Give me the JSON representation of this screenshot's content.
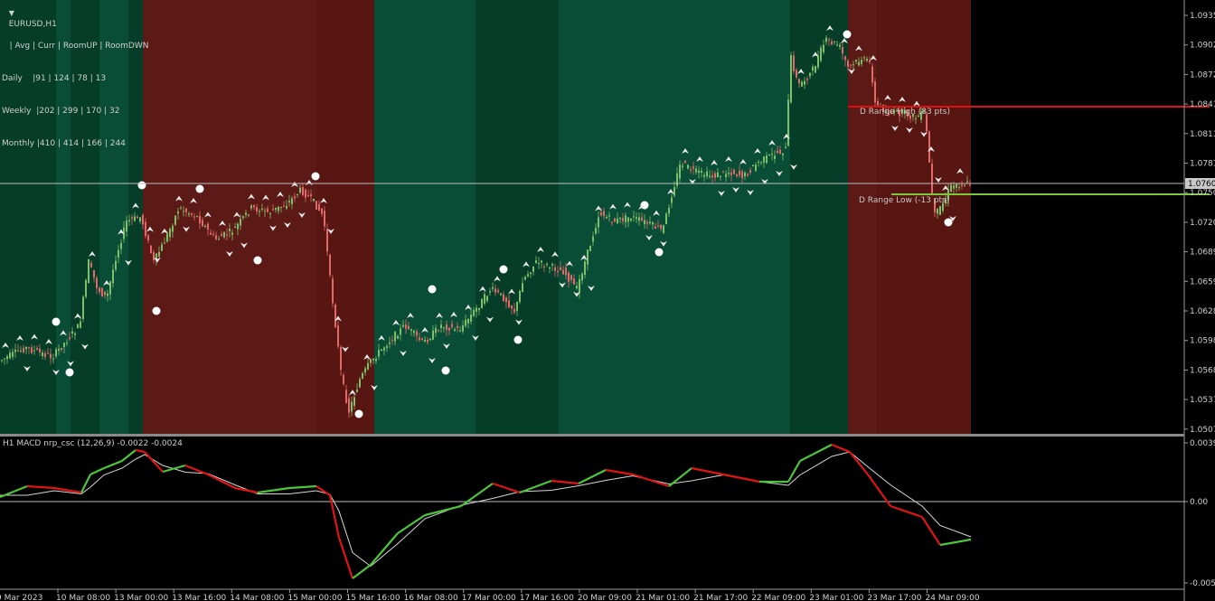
{
  "window": {
    "symbol_title": "EURUSD,H1"
  },
  "stats_table": {
    "header": "   | Avg | Curr | RoomUP | RoomDWN",
    "rows": [
      "Daily    |91 | 124 | 78 | 13",
      "Weekly  |202 | 299 | 170 | 32",
      "Monthly |410 | 414 | 166 | 244"
    ]
  },
  "price_axis": {
    "labels": [
      "1.0935",
      "1.0902",
      "1.0872",
      "1.0841",
      "1.0811",
      "1.0781",
      "1.0750",
      "1.0720",
      "1.0689",
      "1.0659",
      "1.0628",
      "1.0598",
      "1.0568",
      "1.0537",
      "1.0507"
    ],
    "current_price": "1.0760"
  },
  "levels": {
    "range_high_label": "D Range High (83 pts)",
    "range_low_label": "D Range Low (-13 pts)",
    "high_color": "#e01010",
    "low_color": "#7cc83c"
  },
  "macd": {
    "title": "H1 MACD nrp_csc (12,26,9) -0.0022 -0.0024",
    "axis_labels": [
      "0.0039",
      "0.00",
      "-0.0053"
    ]
  },
  "time_axis": {
    "labels": [
      "9 Mar 2023",
      "10 Mar 08:00",
      "13 Mar 00:00",
      "13 Mar 16:00",
      "14 Mar 08:00",
      "15 Mar 00:00",
      "15 Mar 16:00",
      "16 Mar 08:00",
      "17 Mar 00:00",
      "17 Mar 16:00",
      "20 Mar 09:00",
      "21 Mar 01:00",
      "21 Mar 17:00",
      "22 Mar 09:00",
      "23 Mar 01:00",
      "23 Mar 17:00",
      "24 Mar 09:00"
    ]
  },
  "colors": {
    "bull_zone": "#0a4d36",
    "bull_zone_alt": "#063d29",
    "bear_zone": "#5c1a16",
    "bull_candle": "#7dbf6a",
    "bear_candle": "#e06a6a",
    "macd_up": "#4cc63a",
    "macd_down": "#e01414"
  }
}
